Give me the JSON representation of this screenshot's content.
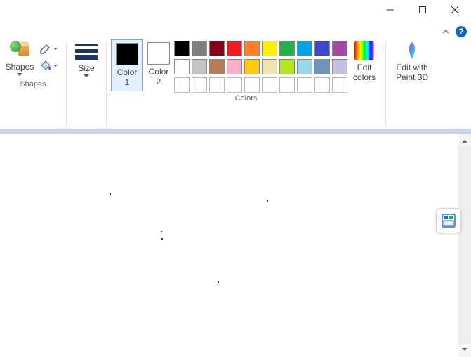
{
  "window": {
    "help": "?"
  },
  "ribbon": {
    "shapes": {
      "label": "Shapes",
      "group_label": "Shapes"
    },
    "size": {
      "label": "Size"
    },
    "color1": {
      "label": "Color\n1",
      "swatch": "#000000"
    },
    "color2": {
      "label": "Color\n2",
      "swatch": "#ffffff"
    },
    "colors_group_label": "Colors",
    "palette": {
      "row1": [
        "#000000",
        "#7f7f7f",
        "#880015",
        "#ed1c24",
        "#ff7f27",
        "#fff200",
        "#22b14c",
        "#00a2e8",
        "#3f48cc",
        "#a349a4"
      ],
      "row2": [
        "#ffffff",
        "#c3c3c3",
        "#b97a57",
        "#ffaec9",
        "#ffc90e",
        "#efe4b0",
        "#b5e61d",
        "#99d9ea",
        "#7092be",
        "#c8bfe7"
      ]
    },
    "edit_colors": {
      "label": "Edit\ncolors"
    },
    "paint3d": {
      "label": "Edit with\nPaint 3D"
    }
  }
}
